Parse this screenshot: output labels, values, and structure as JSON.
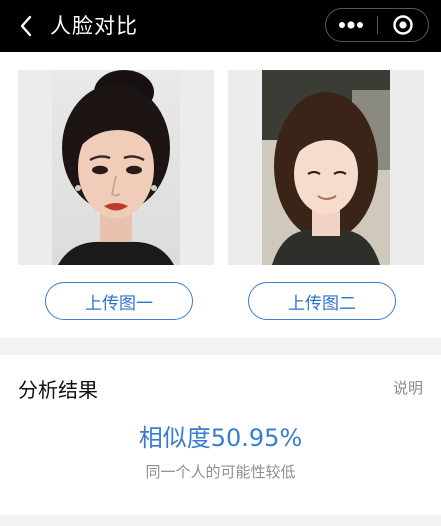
{
  "header": {
    "title": "人脸对比",
    "back_icon": "chevron-left-icon",
    "menu_icon": "more-dots-icon",
    "close_icon": "target-circle-icon"
  },
  "upload": {
    "photo_one": "face-photo",
    "photo_two": "face-photo",
    "button_one_label": "上传图一",
    "button_two_label": "上传图二"
  },
  "result": {
    "heading": "分析结果",
    "explain_label": "说明",
    "similarity_text": "相似度50.95%",
    "similarity_value": 50.95,
    "verdict_text": "同一个人的可能性较低"
  },
  "colors": {
    "accent": "#3a7dd0",
    "titlebar": "#000000",
    "page_bg": "#f2f2f2"
  }
}
